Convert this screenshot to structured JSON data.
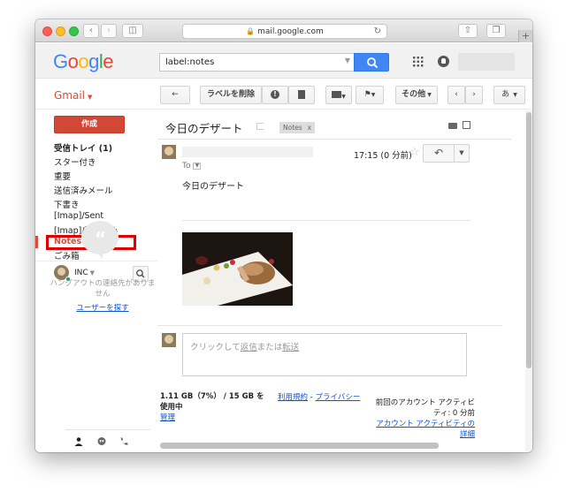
{
  "browser": {
    "url": "mail.google.com"
  },
  "header": {
    "logo_letters": [
      "G",
      "o",
      "o",
      "g",
      "l",
      "e"
    ],
    "search_value": "label:notes"
  },
  "toolbar": {
    "gmail_label": "Gmail",
    "remove_label": "ラベルを削除",
    "more_label": "その他",
    "input_tool_label": "あ"
  },
  "nav": {
    "compose": "作成",
    "items": [
      {
        "label": "受信トレイ (1)"
      },
      {
        "label": "スター付き"
      },
      {
        "label": "重要"
      },
      {
        "label": "送信済みメール"
      },
      {
        "label": "下書き"
      },
      {
        "label": "[Imap]/Sent"
      },
      {
        "label": "[Imap]/送信済み"
      },
      {
        "label": "Notes"
      },
      {
        "label": "ごみ箱"
      }
    ],
    "chat_name": "INC",
    "hangouts_empty": "ハングアウトの連絡先がありません",
    "hangouts_find": "ユーザーを探す"
  },
  "message": {
    "subject": "今日のデザート",
    "label_chip": "Notes",
    "label_chip_close": "x",
    "to": "To",
    "time": "17:15 (0 分前)",
    "body": "今日のデザート",
    "reply_prompt_prefix": "クリックして",
    "reply_link": "返信",
    "reply_middle": "または",
    "forward_link": "転送"
  },
  "footer": {
    "usage": "1.11 GB（7%） / 15 GB を使用中",
    "manage": "管理",
    "terms": "利用規約",
    "privacy": "プライバシー",
    "activity_line1": "前回のアカウント アクティビティ: 0 分前",
    "activity_link": "アカウント アクティビティの詳細"
  },
  "colors": {
    "gmail_red": "#dd4b39",
    "compose_red": "#d14836",
    "search_blue": "#4285f4",
    "highlight_red": "#e00000",
    "link_blue": "#1155cc"
  }
}
